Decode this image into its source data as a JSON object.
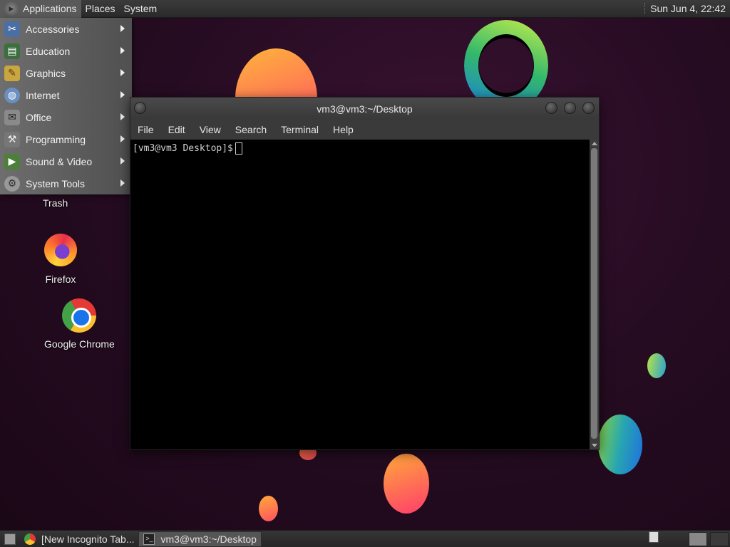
{
  "top_panel": {
    "menus": [
      "Applications",
      "Places",
      "System"
    ],
    "clock": "Sun Jun  4, 22:42"
  },
  "applications_menu": {
    "items": [
      {
        "label": "Accessories",
        "icon": "accessories-icon"
      },
      {
        "label": "Education",
        "icon": "education-icon"
      },
      {
        "label": "Graphics",
        "icon": "graphics-icon"
      },
      {
        "label": "Internet",
        "icon": "internet-icon"
      },
      {
        "label": "Office",
        "icon": "office-icon"
      },
      {
        "label": "Programming",
        "icon": "programming-icon"
      },
      {
        "label": "Sound & Video",
        "icon": "sound-video-icon"
      },
      {
        "label": "System Tools",
        "icon": "system-tools-icon"
      }
    ]
  },
  "desktop_icons": {
    "trash": "Trash",
    "firefox": "Firefox",
    "chrome": "Google Chrome"
  },
  "terminal": {
    "title": "vm3@vm3:~/Desktop",
    "menus": [
      "File",
      "Edit",
      "View",
      "Search",
      "Terminal",
      "Help"
    ],
    "prompt": "[vm3@vm3 Desktop]$"
  },
  "bottom_panel": {
    "tasks": [
      {
        "label": "[New Incognito Tab...",
        "icon": "chrome-icon",
        "active": false
      },
      {
        "label": "vm3@vm3:~/Desktop",
        "icon": "terminal-icon",
        "active": true
      }
    ]
  }
}
